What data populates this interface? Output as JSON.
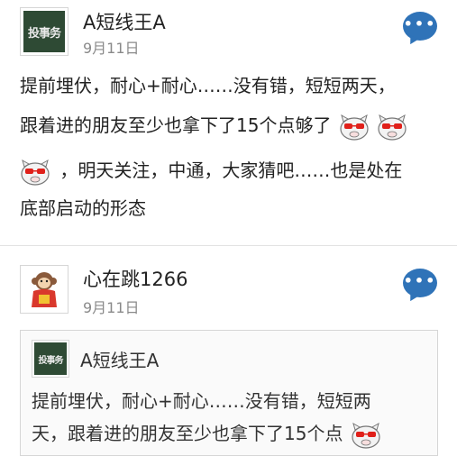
{
  "posts": [
    {
      "username": "A短线王A",
      "avatar_text": "投事务",
      "date": "9月11日",
      "comment_dots": "•••",
      "lines": [
        "提前埋伏，耐心+耐心……没有错，短短两天，",
        "跟着进的朋友至少也拿下了15个点够了",
        "，明天关注，中通，大家猜吧……也是处在",
        "底部启动的形态"
      ],
      "emoji_icon": "cool-pig-emoji-icon"
    },
    {
      "username": "心在跳1266",
      "date": "9月11日",
      "comment_dots": "•••",
      "quote": {
        "username": "A短线王A",
        "avatar_text": "投事务",
        "lines": [
          "提前埋伏，耐心+耐心……没有错，短短两",
          "天，跟着进的朋友至少也拿下了15个点"
        ]
      }
    }
  ],
  "colors": {
    "accent": "#2f73b8",
    "avatar_bg": "#2e4a34",
    "date": "#8a8a8a",
    "divider": "#e3e3e3"
  }
}
